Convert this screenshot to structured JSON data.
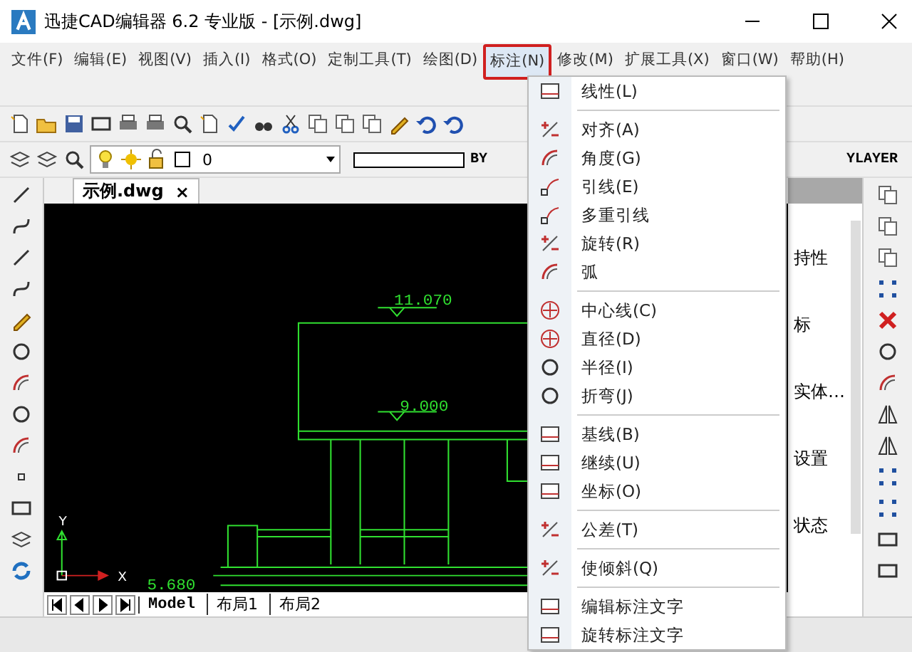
{
  "window": {
    "title": "迅捷CAD编辑器 6.2 专业版  - [示例.dwg]"
  },
  "menubar": [
    {
      "label": "文件(F)",
      "selected": false
    },
    {
      "label": "编辑(E)",
      "selected": false
    },
    {
      "label": "视图(V)",
      "selected": false
    },
    {
      "label": "插入(I)",
      "selected": false
    },
    {
      "label": "格式(O)",
      "selected": false
    },
    {
      "label": "定制工具(T)",
      "selected": false
    },
    {
      "label": "绘图(D)",
      "selected": false
    },
    {
      "label": "标注(N)",
      "selected": true
    },
    {
      "label": "修改(M)",
      "selected": false
    },
    {
      "label": "扩展工具(X)",
      "selected": false
    },
    {
      "label": "窗口(W)",
      "selected": false
    },
    {
      "label": "帮助(H)",
      "selected": false
    }
  ],
  "layer_bar": {
    "layer": "0",
    "linetype": "BY",
    "lineweight": "YLAYER"
  },
  "document_tab": {
    "label": "示例.dwg",
    "close": "×"
  },
  "drawing": {
    "elevations": [
      "11.070",
      "9.000",
      "5.680"
    ],
    "axis_y": "Y",
    "axis_x": "X"
  },
  "layout_tabs": [
    {
      "label": "Model",
      "selected": true
    },
    {
      "label": "布局1",
      "selected": false
    },
    {
      "label": "布局2",
      "selected": false
    }
  ],
  "properties_panel": {
    "lines": [
      "持性",
      "标",
      "实体…",
      "设置",
      "状态"
    ]
  },
  "dimension_menu": [
    {
      "kind": "item",
      "label": "线性(L)"
    },
    {
      "kind": "separator"
    },
    {
      "kind": "item",
      "label": "对齐(A)"
    },
    {
      "kind": "item",
      "label": "角度(G)"
    },
    {
      "kind": "item",
      "label": "引线(E)"
    },
    {
      "kind": "item",
      "label": "多重引线"
    },
    {
      "kind": "item",
      "label": "旋转(R)"
    },
    {
      "kind": "item",
      "label": "弧"
    },
    {
      "kind": "separator"
    },
    {
      "kind": "item",
      "label": "中心线(C)"
    },
    {
      "kind": "item",
      "label": "直径(D)"
    },
    {
      "kind": "item",
      "label": "半径(I)"
    },
    {
      "kind": "item",
      "label": "折弯(J)"
    },
    {
      "kind": "separator"
    },
    {
      "kind": "item",
      "label": "基线(B)"
    },
    {
      "kind": "item",
      "label": "继续(U)"
    },
    {
      "kind": "item",
      "label": "坐标(O)"
    },
    {
      "kind": "separator"
    },
    {
      "kind": "item",
      "label": "公差(T)"
    },
    {
      "kind": "separator"
    },
    {
      "kind": "item",
      "label": "使倾斜(Q)"
    },
    {
      "kind": "separator"
    },
    {
      "kind": "item",
      "label": "编辑标注文字"
    },
    {
      "kind": "item",
      "label": "旋转标注文字"
    }
  ]
}
